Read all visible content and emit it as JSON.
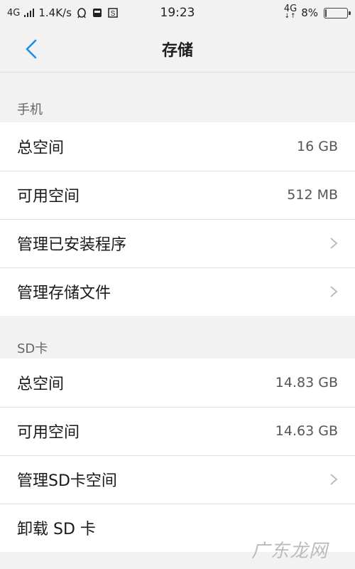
{
  "status_bar": {
    "network_left": "4G",
    "speed": "1.4K/s",
    "time": "19:23",
    "network_right": "4G",
    "battery": "8%",
    "battery_level": 0.08,
    "icons": [
      "signal-icon",
      "qq-icon",
      "sim-icon",
      "screenshot-icon",
      "battery-icon"
    ]
  },
  "header": {
    "title": "存储",
    "back_icon": "chevron-left-icon"
  },
  "sections": {
    "phone": {
      "label": "手机",
      "rows": [
        {
          "label": "总空间",
          "value": "16 GB"
        },
        {
          "label": "可用空间",
          "value": "512 MB"
        },
        {
          "label": "管理已安装程序"
        },
        {
          "label": "管理存储文件"
        }
      ]
    },
    "sd": {
      "label": "SD卡",
      "rows": [
        {
          "label": "总空间",
          "value": "14.83 GB"
        },
        {
          "label": "可用空间",
          "value": "14.63 GB"
        },
        {
          "label": "管理SD卡空间"
        },
        {
          "label": "卸载 SD 卡"
        }
      ]
    }
  },
  "colors": {
    "accent": "#1a8fe6",
    "background": "#f2f2f2",
    "card": "#ffffff"
  },
  "watermark": "广东龙网"
}
